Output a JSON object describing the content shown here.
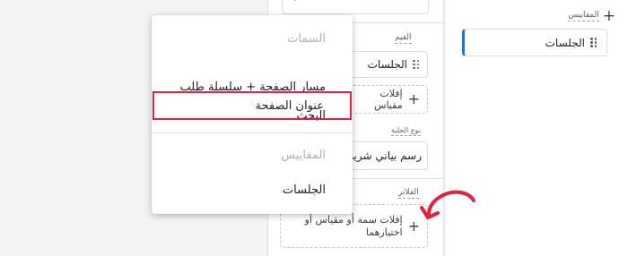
{
  "config_panel": {
    "dimensions_label": "القيم",
    "dimension_chip": "الجلسات",
    "dimension_add": "إفلات مقياس",
    "chart_type_label": "نوع الخلية",
    "chart_type_value": "رسم بياني شريطي",
    "filters_label": "الفلاتر",
    "filters_add": "إفلات سمة أو مقياس أو اختيارهما"
  },
  "right_panel": {
    "metrics_label": "المقاييس",
    "metric_chip": "الجلسات"
  },
  "dropdown_menu": {
    "attributes_header": "السمات",
    "items_attributes": [
      "مسار الصفحة + سلسلة طلب البحث",
      "عنوان الصفحة"
    ],
    "metrics_header": "المقاييس",
    "items_metrics": [
      "الجلسات"
    ],
    "highlighted_item": "عنوان الصفحة"
  },
  "annotation": {
    "color": "#e0223f"
  },
  "colors": {
    "accent": "#1a73e8",
    "highlight": "#e0223f"
  }
}
